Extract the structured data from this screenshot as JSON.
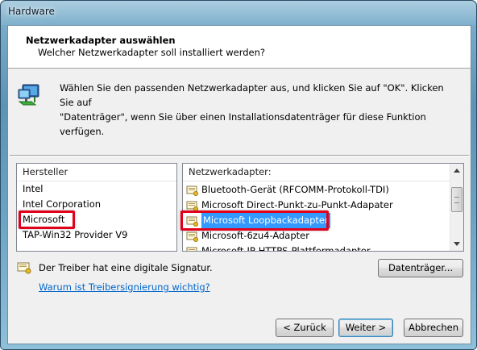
{
  "window": {
    "title": "Hardware"
  },
  "header": {
    "title": "Netzwerkadapter auswählen",
    "subtitle": "Welcher Netzwerkadapter soll installiert werden?"
  },
  "info": {
    "icon": "network-adapter-icon",
    "line1": "Wählen Sie den passenden Netzwerkadapter aus, und klicken Sie auf \"OK\". Klicken Sie auf",
    "line2": "\"Datenträger\", wenn Sie über einen Installationsdatenträger für diese Funktion verfügen."
  },
  "manufacturers": {
    "header": "Hersteller",
    "items": [
      "Intel",
      "Intel Corporation",
      "Microsoft",
      "TAP-Win32 Provider V9"
    ],
    "selected": "Microsoft"
  },
  "adapters": {
    "header": "Netzwerkadapter:",
    "items": [
      "Bluetooth-Gerät (RFCOMM-Protokoll-TDI)",
      "Microsoft Direct-Punkt-zu-Punkt-Adapater",
      "Microsoft Loopbackadapter",
      "Microsoft-6zu4-Adapter",
      "Microsoft-IP-HTTPS-Plattformadapter"
    ],
    "selected": "Microsoft Loopbackadapter"
  },
  "signature": {
    "text": "Der Treiber hat eine digitale Signatur.",
    "link": "Warum ist Treibersignierung wichtig?"
  },
  "buttons": {
    "disk": "Datenträger...",
    "back": "< Zurück",
    "next": "Weiter >",
    "cancel": "Abbrechen"
  },
  "colors": {
    "selection": "#3399ff",
    "highlight_box": "#e0001b",
    "link": "#0066cc"
  }
}
